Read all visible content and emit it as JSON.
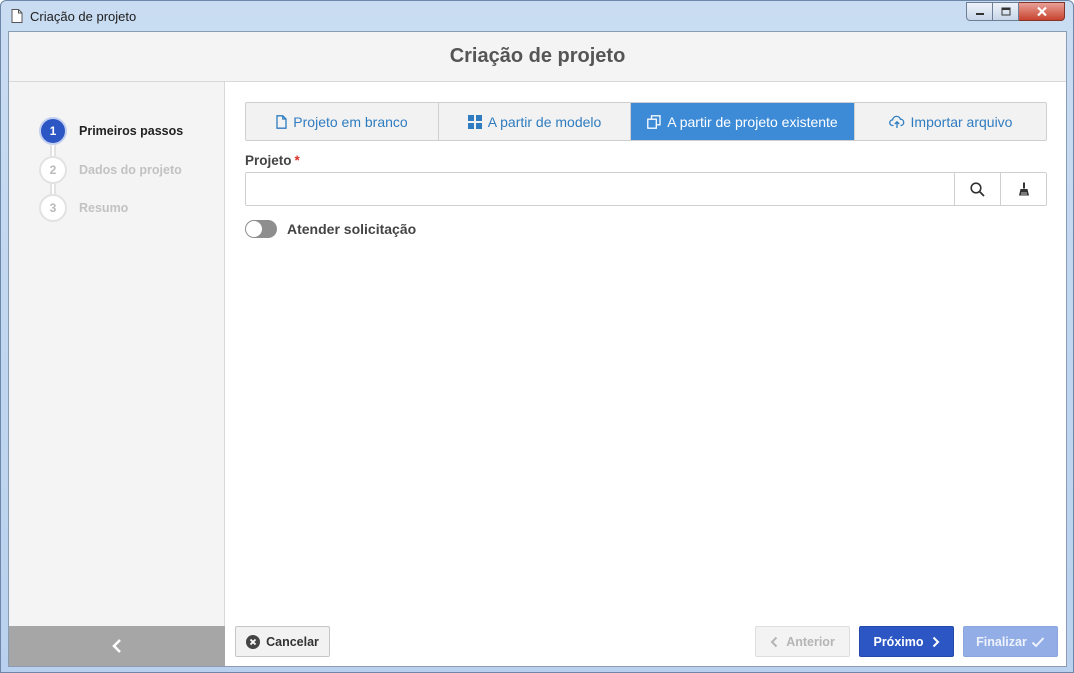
{
  "window": {
    "title": "Criação de projeto"
  },
  "header": {
    "title": "Criação de projeto"
  },
  "steps": [
    {
      "number": "1",
      "label": "Primeiros passos",
      "active": true
    },
    {
      "number": "2",
      "label": "Dados do projeto",
      "active": false
    },
    {
      "number": "3",
      "label": "Resumo",
      "active": false
    }
  ],
  "tabs": [
    {
      "label": "Projeto em branco",
      "icon": "document-icon",
      "active": false
    },
    {
      "label": "A partir de modelo",
      "icon": "grid-icon",
      "active": false
    },
    {
      "label": "A partir de projeto existente",
      "icon": "copy-icon",
      "active": true
    },
    {
      "label": "Importar arquivo",
      "icon": "cloud-upload-icon",
      "active": false
    }
  ],
  "form": {
    "project_label": "Projeto",
    "required_mark": "*",
    "project_value": "",
    "toggle_label": "Atender solicitação",
    "toggle_on": false
  },
  "footer": {
    "cancel": "Cancelar",
    "previous": "Anterior",
    "next": "Próximo",
    "finish": "Finalizar"
  },
  "colors": {
    "primary": "#2b56c4",
    "tab_active": "#3d8bd7",
    "tab_text": "#2f7cc0",
    "required": "#d9322b"
  }
}
